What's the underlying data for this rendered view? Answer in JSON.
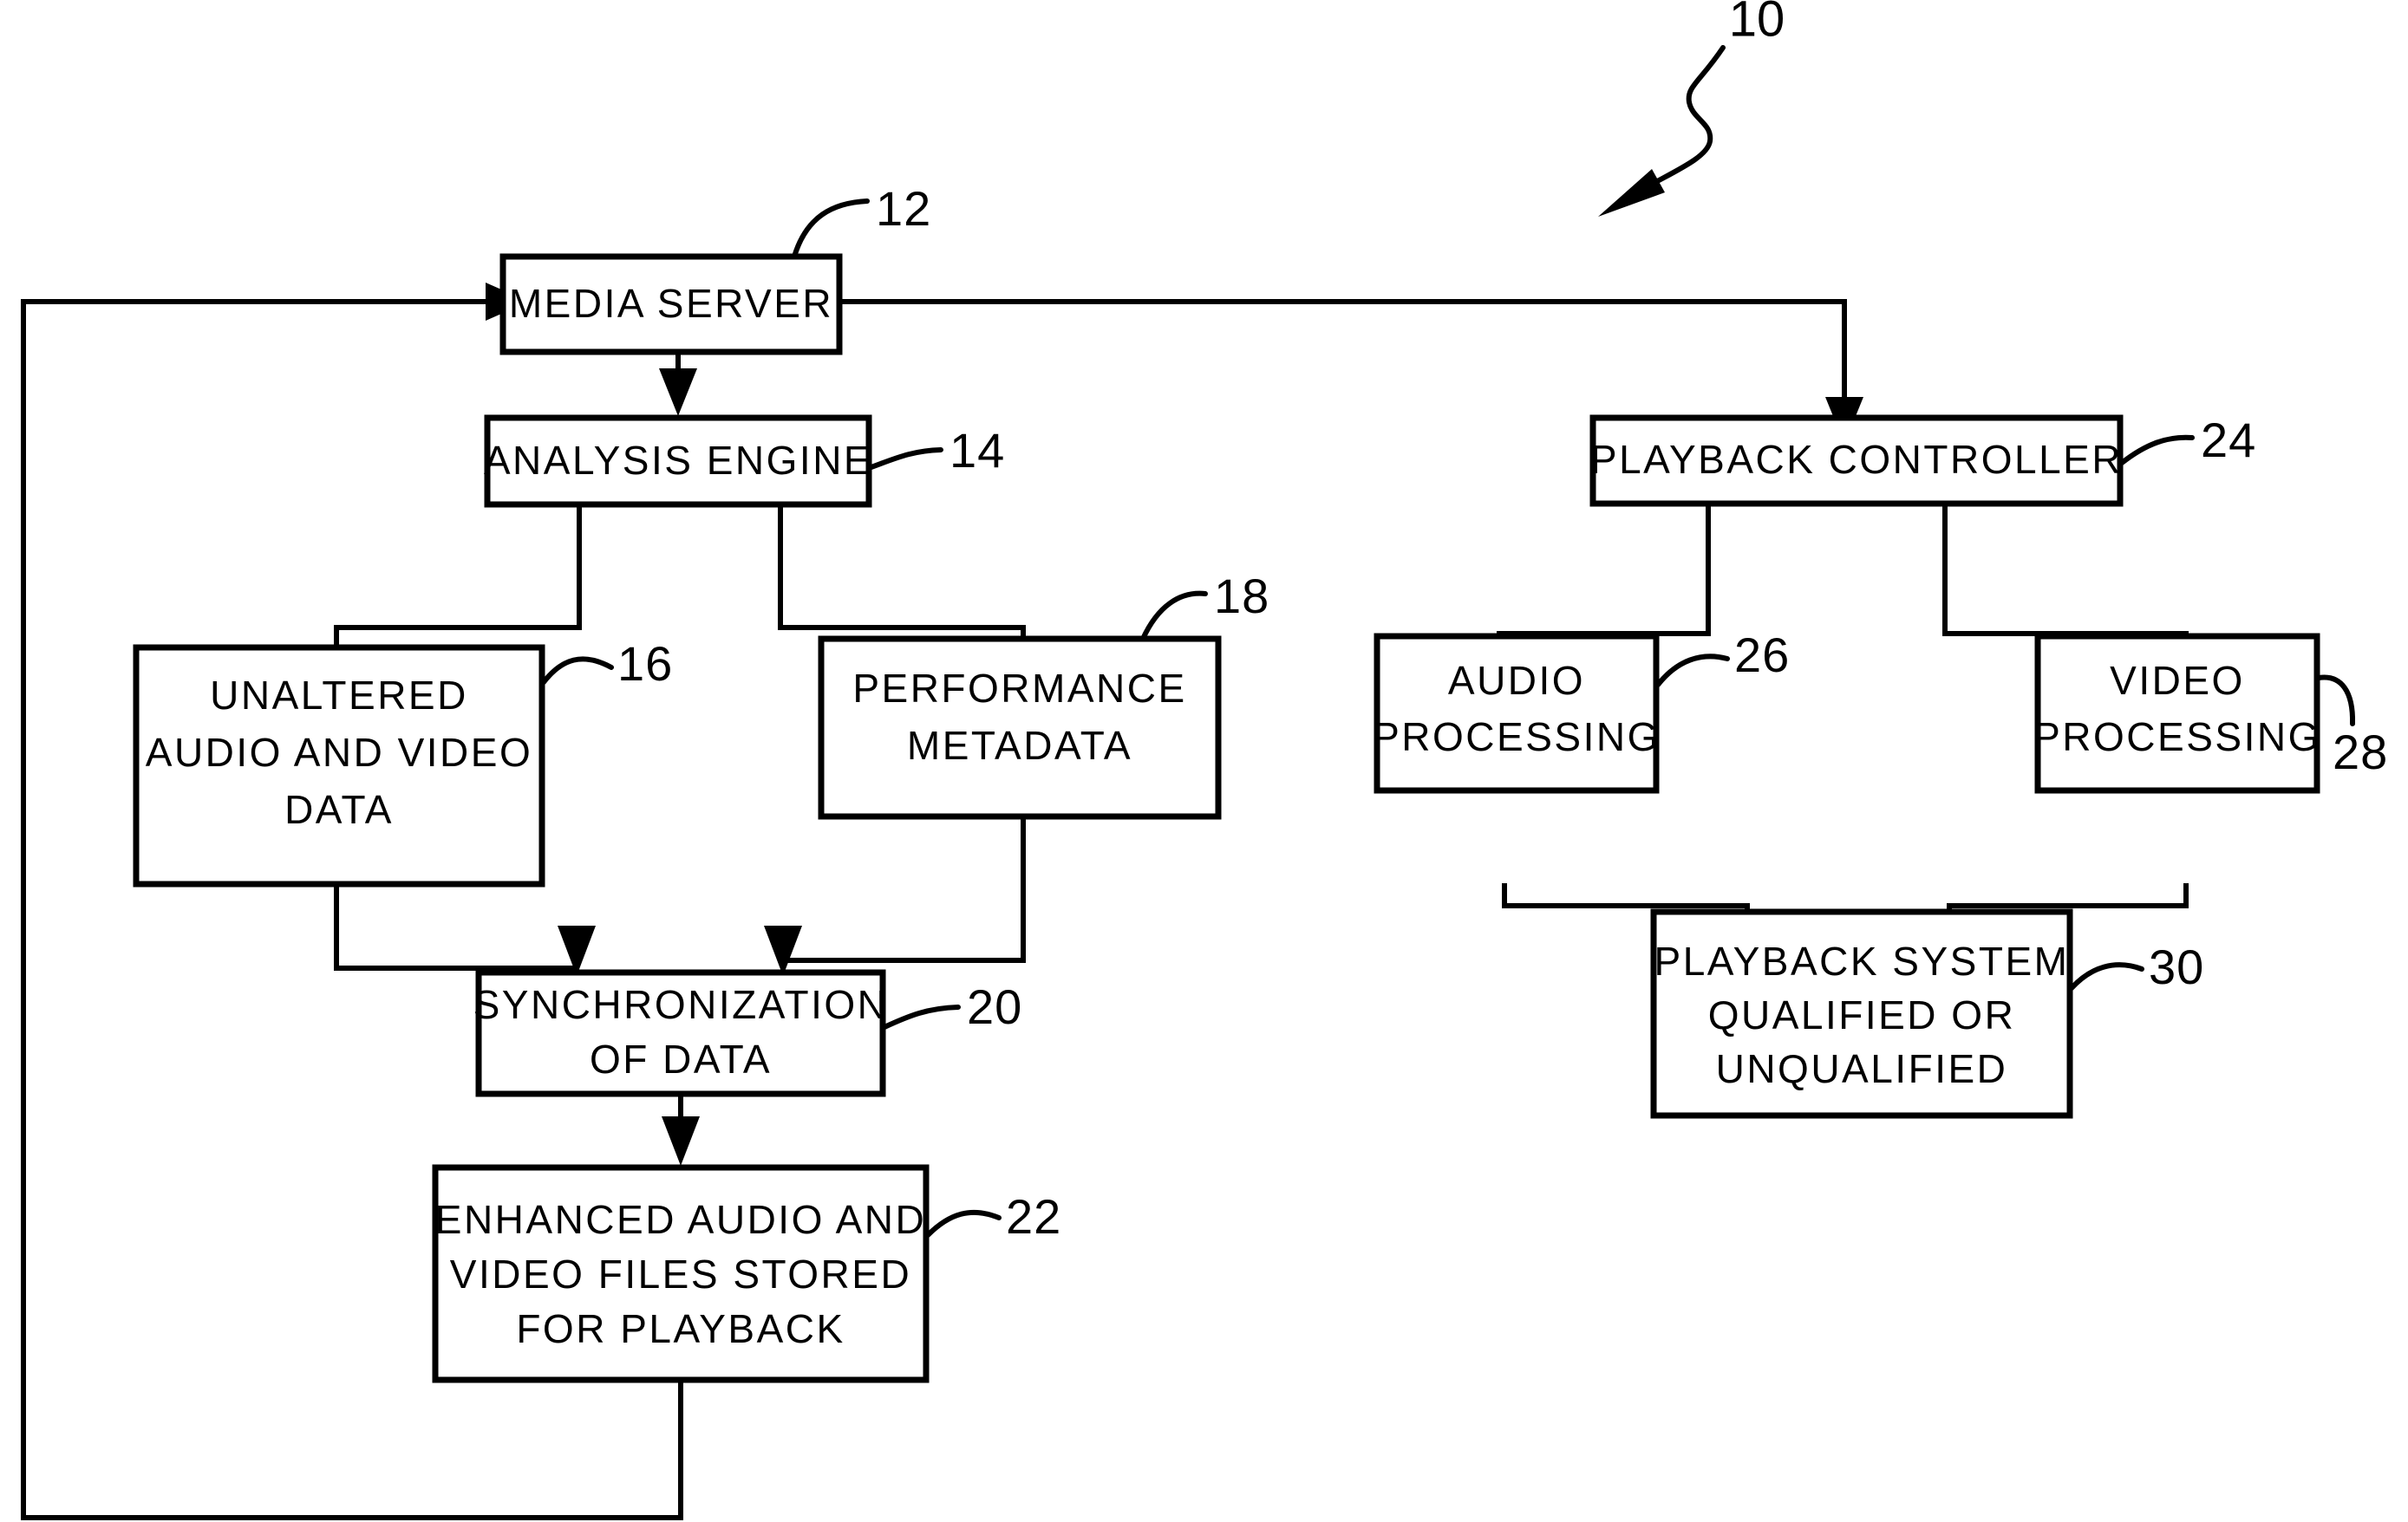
{
  "figure": {
    "reference_label": "10",
    "background_color": "#ffffff",
    "line_color": "#000000"
  },
  "nodes": [
    {
      "id": "media-server",
      "ref": "12",
      "lines": [
        "MEDIA  SERVER"
      ]
    },
    {
      "id": "analysis-engine",
      "ref": "14",
      "lines": [
        "ANALYSIS  ENGINE"
      ]
    },
    {
      "id": "unaltered-data",
      "ref": "16",
      "lines": [
        "UNALTERED",
        "AUDIO AND VIDEO",
        "DATA"
      ]
    },
    {
      "id": "performance-metadata",
      "ref": "18",
      "lines": [
        "PERFORMANCE",
        "METADATA"
      ]
    },
    {
      "id": "synchronization",
      "ref": "20",
      "lines": [
        "SYNCHRONIZATION",
        "OF DATA"
      ]
    },
    {
      "id": "enhanced-files",
      "ref": "22",
      "lines": [
        "ENHANCED AUDIO AND",
        "VIDEO FILES STORED",
        "FOR PLAYBACK"
      ]
    },
    {
      "id": "playback-controller",
      "ref": "24",
      "lines": [
        "PLAYBACK  CONTROLLER"
      ]
    },
    {
      "id": "audio-processing",
      "ref": "26",
      "lines": [
        "AUDIO",
        "PROCESSING"
      ]
    },
    {
      "id": "video-processing",
      "ref": "28",
      "lines": [
        "VIDEO",
        "PROCESSING"
      ]
    },
    {
      "id": "playback-system",
      "ref": "30",
      "lines": [
        "PLAYBACK SYSTEM",
        "QUALIFIED OR",
        "UNQUALIFIED"
      ]
    }
  ],
  "text": {
    "media_server": "MEDIA  SERVER",
    "media_server_ref": "12",
    "analysis_engine": "ANALYSIS  ENGINE",
    "analysis_engine_ref": "14",
    "unaltered_l1": "UNALTERED",
    "unaltered_l2": "AUDIO AND VIDEO",
    "unaltered_l3": "DATA",
    "unaltered_ref": "16",
    "metadata_l1": "PERFORMANCE",
    "metadata_l2": "METADATA",
    "metadata_ref": "18",
    "sync_l1": "SYNCHRONIZATION",
    "sync_l2": "OF DATA",
    "sync_ref": "20",
    "enhanced_l1": "ENHANCED AUDIO AND",
    "enhanced_l2": "VIDEO FILES STORED",
    "enhanced_l3": "FOR PLAYBACK",
    "enhanced_ref": "22",
    "playback_controller": "PLAYBACK  CONTROLLER",
    "playback_controller_ref": "24",
    "audio_l1": "AUDIO",
    "audio_l2": "PROCESSING",
    "audio_ref": "26",
    "video_l1": "VIDEO",
    "video_l2": "PROCESSING",
    "video_ref": "28",
    "system_l1": "PLAYBACK SYSTEM",
    "system_l2": "QUALIFIED OR",
    "system_l3": "UNQUALIFIED",
    "system_ref": "30",
    "figure_ref": "10"
  }
}
